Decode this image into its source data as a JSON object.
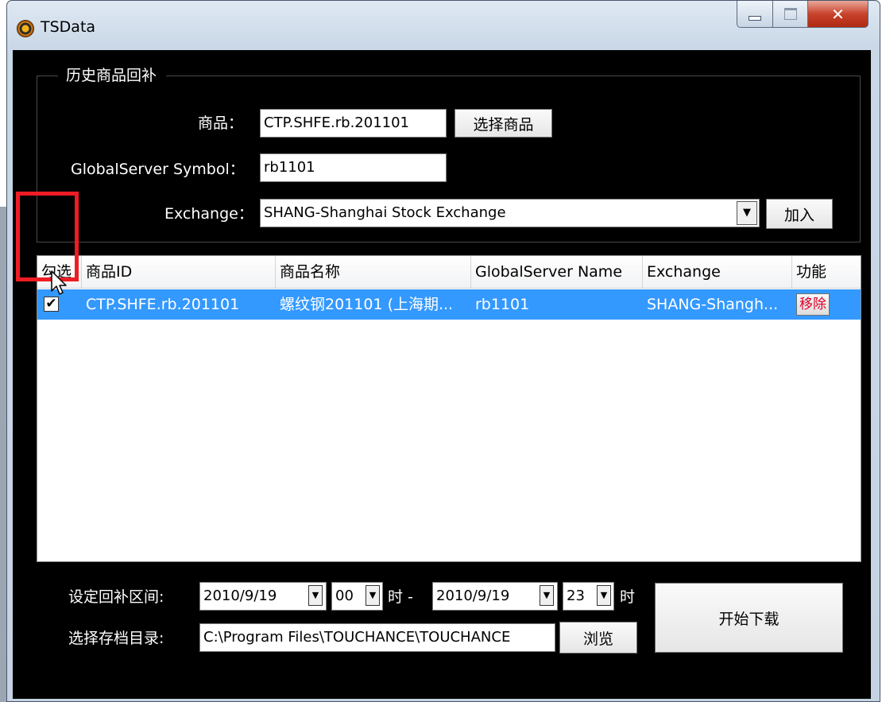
{
  "window": {
    "title": "TSData"
  },
  "group": {
    "title": "历史商品回补"
  },
  "form": {
    "product_label": "商品：",
    "product_value": "CTP.SHFE.rb.201101",
    "select_product_button": "选择商品",
    "symbol_label": "GlobalServer Symbol：",
    "symbol_value": "rb1101",
    "exchange_label": "Exchange：",
    "exchange_value": "SHANG-Shanghai Stock Exchange",
    "add_button": "加入"
  },
  "table": {
    "columns": [
      "勾选",
      "商品ID",
      "商品名称",
      "GlobalServer Name",
      "Exchange",
      "功能"
    ],
    "rows": [
      {
        "checked": true,
        "product_id": "CTP.SHFE.rb.201101",
        "product_name": "螺纹钢201101 (上海期...",
        "globalserver_name": "rb1101",
        "exchange": "SHANG-Shangh...",
        "action": "移除"
      }
    ]
  },
  "range": {
    "label": "设定回补区间:",
    "start_date": "2010/9/19",
    "start_hour": "00",
    "hour_sep": "时 -",
    "end_date": "2010/9/19",
    "end_hour": "23",
    "hour_suffix": "时"
  },
  "dir": {
    "label": "选择存档目录:",
    "path": "C:\\Program Files\\TOUCHANCE\\TOUCHANCE",
    "browse_button": "浏览"
  },
  "start_button": "开始下载",
  "colors": {
    "selection": "#3399ff",
    "highlight": "#ee1c24",
    "remove_text": "#e0002a"
  }
}
